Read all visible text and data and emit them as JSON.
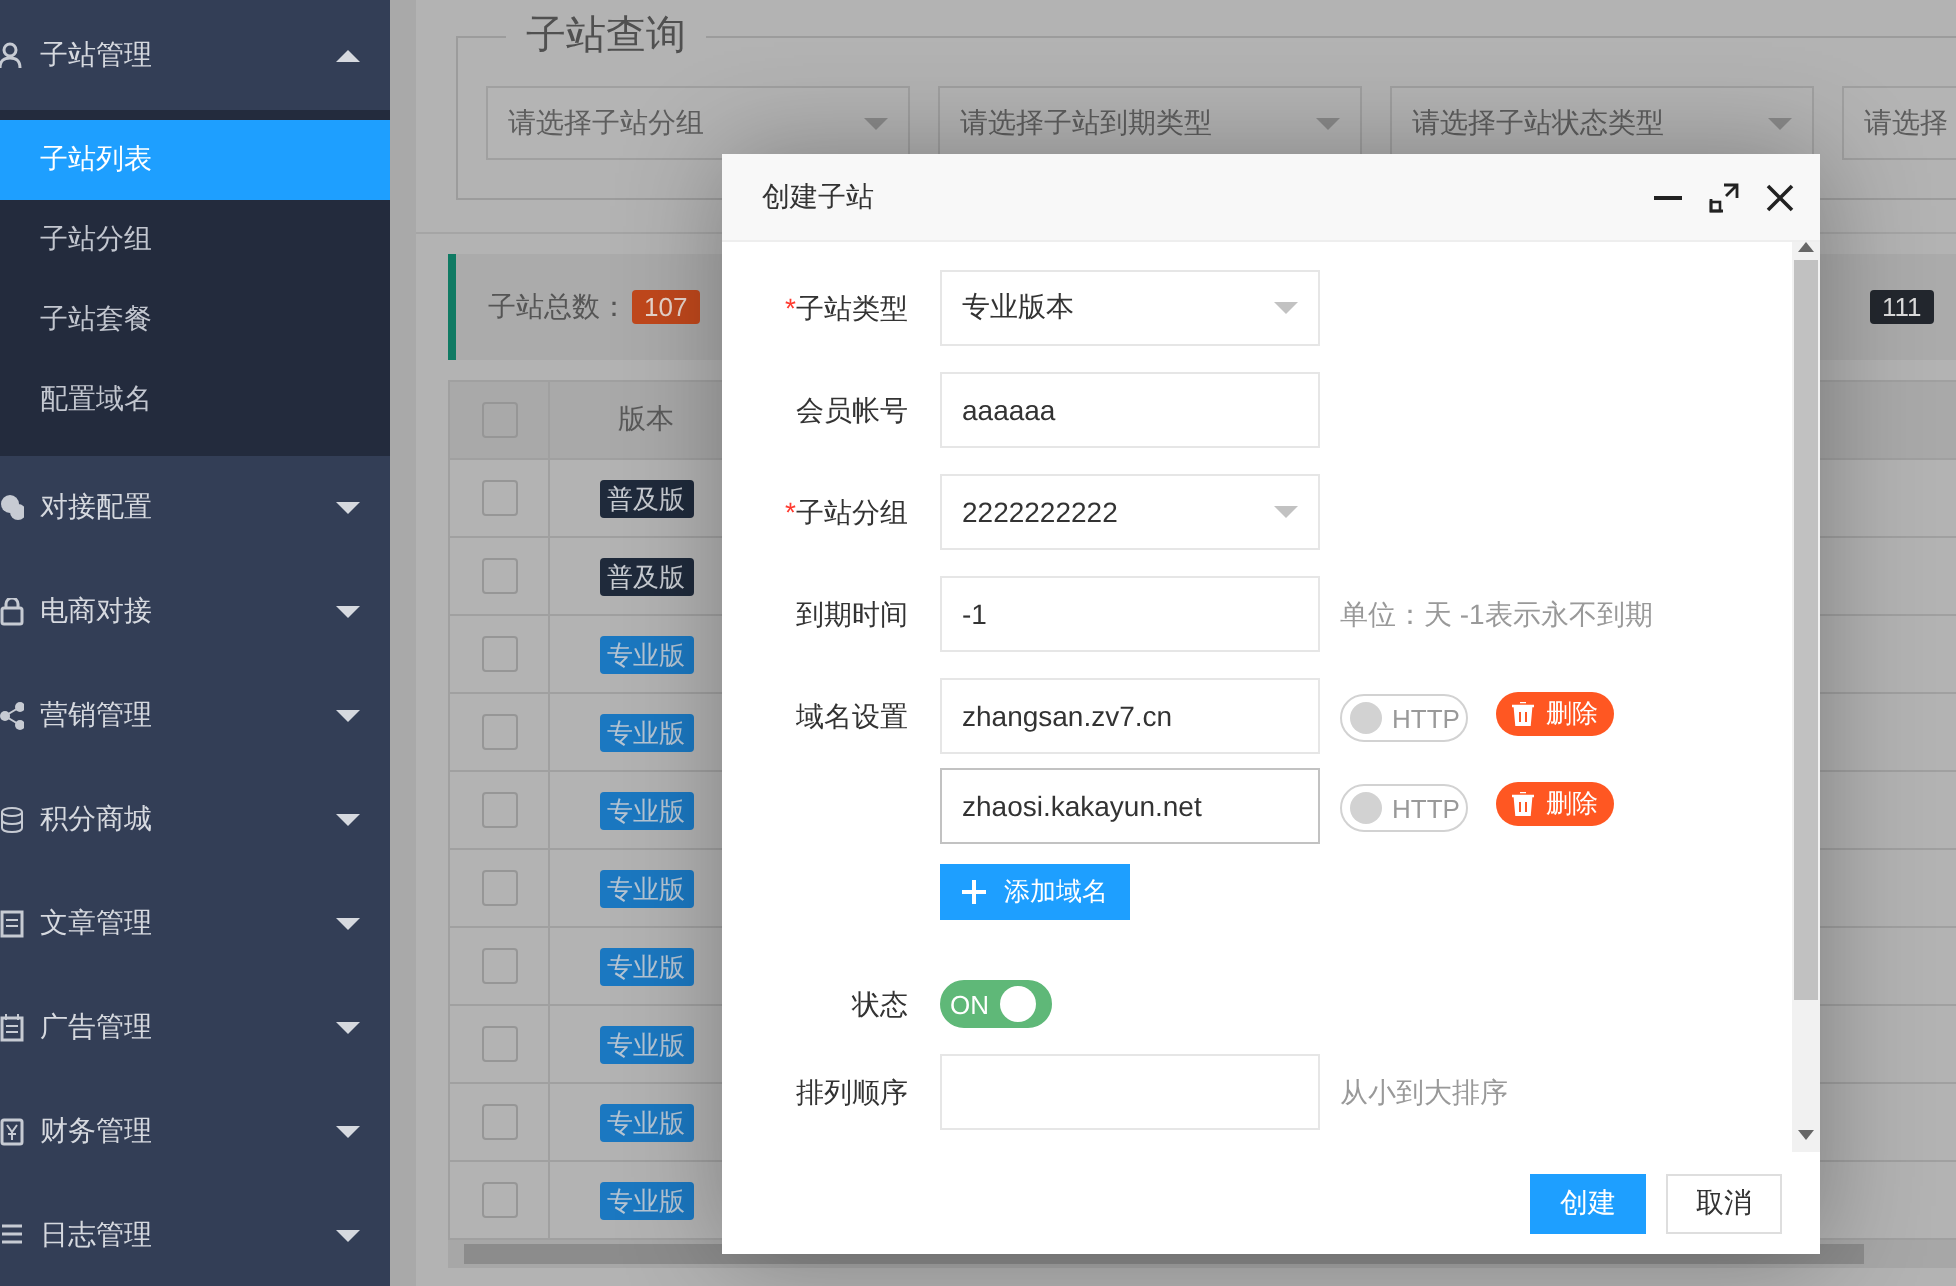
{
  "sidebar": {
    "items": [
      {
        "label": "子站管理",
        "expanded": true,
        "children": [
          {
            "label": "子站列表",
            "selected": true
          },
          {
            "label": "子站分组",
            "selected": false
          },
          {
            "label": "子站套餐",
            "selected": false
          },
          {
            "label": "配置域名",
            "selected": false
          }
        ]
      },
      {
        "label": "对接配置",
        "expanded": false
      },
      {
        "label": "电商对接",
        "expanded": false
      },
      {
        "label": "营销管理",
        "expanded": false
      },
      {
        "label": "积分商城",
        "expanded": false
      },
      {
        "label": "文章管理",
        "expanded": false
      },
      {
        "label": "广告管理",
        "expanded": false
      },
      {
        "label": "财务管理",
        "expanded": false
      },
      {
        "label": "日志管理",
        "expanded": false
      }
    ]
  },
  "search_panel": {
    "title": "子站查询",
    "filters": [
      {
        "placeholder": "请选择子站分组"
      },
      {
        "placeholder": "请选择子站到期类型"
      },
      {
        "placeholder": "请选择子站状态类型"
      },
      {
        "placeholder": "请选择"
      }
    ]
  },
  "stats": {
    "total_label": "子站总数：",
    "total": "107",
    "count_2": "111"
  },
  "table": {
    "header_checked": false,
    "columns": [
      "版本"
    ],
    "rows": [
      {
        "checked": false,
        "kind": "basic",
        "version": "普及版"
      },
      {
        "checked": false,
        "kind": "basic",
        "version": "普及版"
      },
      {
        "checked": false,
        "kind": "pro",
        "version": "专业版"
      },
      {
        "checked": false,
        "kind": "pro",
        "version": "专业版"
      },
      {
        "checked": false,
        "kind": "pro",
        "version": "专业版"
      },
      {
        "checked": false,
        "kind": "pro",
        "version": "专业版"
      },
      {
        "checked": false,
        "kind": "pro",
        "version": "专业版"
      },
      {
        "checked": false,
        "kind": "pro",
        "version": "专业版"
      },
      {
        "checked": false,
        "kind": "pro",
        "version": "专业版"
      },
      {
        "checked": false,
        "kind": "pro",
        "version": "专业版"
      }
    ]
  },
  "dialog": {
    "title": "创建子站",
    "fields": [
      {
        "kind": "select",
        "label": "子站类型",
        "required_mark": "*",
        "value": "专业版本"
      },
      {
        "kind": "text",
        "label": "会员帐号",
        "value": "aaaaaa"
      },
      {
        "kind": "select",
        "label": "子站分组",
        "required_mark": "*",
        "value": "2222222222"
      },
      {
        "kind": "text",
        "label": "到期时间",
        "value": "-1",
        "hint": "单位：天 -1表示永不到期"
      },
      {
        "kind": "domains",
        "label": "域名设置",
        "add_button": "添加域名",
        "domains": [
          {
            "value": "zhangsan.zv7.cn",
            "focused": false,
            "http_label": "HTTP",
            "http_on": false,
            "delete": "删除"
          },
          {
            "value": "zhaosi.kakayun.net",
            "focused": true,
            "http_label": "HTTP",
            "http_on": false,
            "delete": "删除"
          }
        ]
      },
      {
        "kind": "switch",
        "label": "状态",
        "on": true,
        "switch_text": "ON"
      },
      {
        "kind": "text",
        "label": "排列顺序",
        "hint": "从小到大排序"
      }
    ],
    "buttons": [
      {
        "label": "创建",
        "kind": "primary"
      },
      {
        "label": "取消",
        "kind": "default"
      }
    ]
  }
}
